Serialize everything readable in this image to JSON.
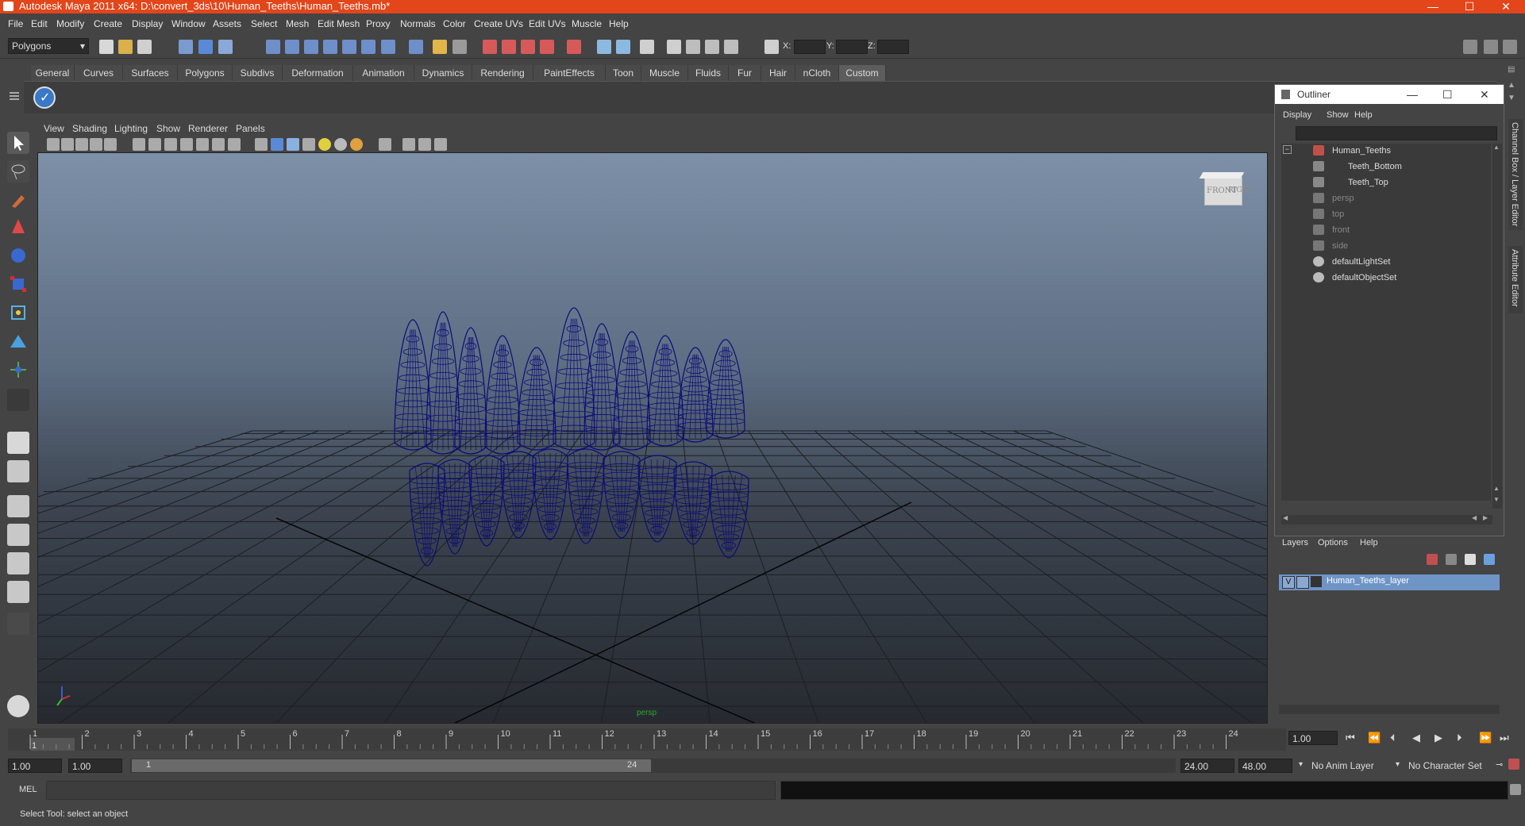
{
  "window": {
    "title": "Autodesk Maya 2011 x64: D:\\convert_3ds\\10\\Human_Teeths\\Human_Teeths.mb*",
    "minimize": "—",
    "maximize": "☐",
    "close": "✕"
  },
  "menubar": [
    "File",
    "Edit",
    "Modify",
    "Create",
    "Display",
    "Window",
    "Assets",
    "Select",
    "Mesh",
    "Edit Mesh",
    "Proxy",
    "Normals",
    "Color",
    "Create UVs",
    "Edit UVs",
    "Muscle",
    "Help"
  ],
  "statusline": {
    "mode": "Polygons",
    "x_label": "X:",
    "y_label": "Y:",
    "z_label": "Z:"
  },
  "shelf": {
    "tabs": [
      "General",
      "Curves",
      "Surfaces",
      "Polygons",
      "Subdivs",
      "Deformation",
      "Animation",
      "Dynamics",
      "Rendering",
      "PaintEffects",
      "Toon",
      "Muscle",
      "Fluids",
      "Fur",
      "Hair",
      "nCloth",
      "Custom"
    ],
    "active_tab": "Custom"
  },
  "viewport": {
    "menus": [
      "View",
      "Shading",
      "Lighting",
      "Show",
      "Renderer",
      "Panels"
    ],
    "camera_label": "persp",
    "viewcube_front": "FRONT",
    "viewcube_right": "RIGHT",
    "wire_color": "#0b0b7a"
  },
  "outliner": {
    "title": "Outliner",
    "menus": [
      "Display",
      "Show",
      "Help"
    ],
    "items": [
      {
        "label": "Human_Teeths",
        "dim": false
      },
      {
        "label": "Teeth_Bottom",
        "dim": false
      },
      {
        "label": "Teeth_Top",
        "dim": false
      },
      {
        "label": "persp",
        "dim": true
      },
      {
        "label": "top",
        "dim": true
      },
      {
        "label": "front",
        "dim": true
      },
      {
        "label": "side",
        "dim": true
      },
      {
        "label": "defaultLightSet",
        "dim": false
      },
      {
        "label": "defaultObjectSet",
        "dim": false
      }
    ]
  },
  "layers": {
    "menus": [
      "Layers",
      "Options",
      "Help"
    ],
    "visibility": "V",
    "layer_name": "Human_Teeths_layer"
  },
  "sidebar_tabs": [
    "Channel Box / Layer Editor",
    "Attribute Editor"
  ],
  "timeline": {
    "ticks": [
      "1",
      "2",
      "3",
      "4",
      "5",
      "6",
      "7",
      "8",
      "9",
      "10",
      "11",
      "12",
      "13",
      "14",
      "15",
      "16",
      "17",
      "18",
      "19",
      "20",
      "21",
      "22",
      "23",
      "24"
    ],
    "current_frame": "1.00",
    "current_marker": "1"
  },
  "range": {
    "start": "1.00",
    "anim_start": "1.00",
    "slider_start": "1",
    "slider_end": "24",
    "end": "24.00",
    "anim_end": "48.00",
    "anim_layer": "No Anim Layer",
    "char_set": "No Character Set"
  },
  "cmdline": {
    "label": "MEL"
  },
  "helpline": {
    "text": "Select Tool: select an object"
  }
}
